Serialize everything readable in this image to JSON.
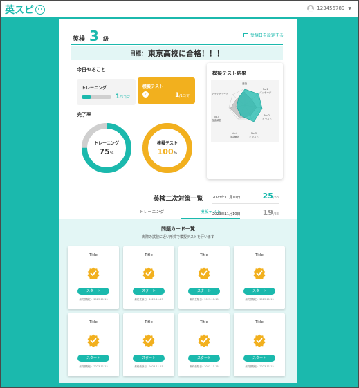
{
  "app": {
    "logo_text": "英スピ",
    "logo_icon": "face-icon"
  },
  "user": {
    "id": "123456789",
    "avatar_icon": "user-icon",
    "menu_icon": "caret-down-icon"
  },
  "header": {
    "grade_prefix": "英検",
    "grade_number": "3",
    "grade_suffix": "級",
    "exam_date_link": "受験日を設定する",
    "calendar_icon": "calendar-icon"
  },
  "goal": {
    "prefix": "目標：",
    "text": "東京高校に合格！！！"
  },
  "today": {
    "title": "今日やること",
    "training": {
      "label": "トレーニング",
      "done": "1",
      "total": "/3コマ",
      "progress": 0.33
    },
    "mock": {
      "label": "模擬テスト",
      "done": "1",
      "total": "/1コマ",
      "check_icon": "check-circle-icon"
    }
  },
  "completion": {
    "title": "完了率",
    "training": {
      "label": "トレーニング",
      "value": "75",
      "unit": "%",
      "percent": 75
    },
    "mock": {
      "label": "模擬テスト",
      "value": "100",
      "unit": "%",
      "percent": 100
    }
  },
  "results": {
    "title": "模擬テスト結果",
    "radar_labels": [
      "音読",
      "No.1\nパッセージ",
      "No.2\nイラスト",
      "No.3\nイラスト",
      "No.4\n自由解答",
      "No.5\n自由解答",
      "アティチュード"
    ],
    "scores": [
      {
        "date": "2023年11月10日",
        "value": "25",
        "total": "/33"
      },
      {
        "date": "2023年11月10日",
        "value": "19",
        "total": "/33"
      }
    ]
  },
  "list": {
    "title": "英検二次対策一覧",
    "tabs": [
      {
        "label": "トレーニング"
      },
      {
        "label": "模擬テスト"
      }
    ],
    "cards_title": "問題カード一覧",
    "cards_subtitle": "実際の試験に近い形式で模擬テストを行います",
    "cards": [
      {
        "title": "Title",
        "button": "スタート",
        "date": "最終受験日：2023-11-15"
      },
      {
        "title": "Title",
        "button": "スタート",
        "date": "最終受験日：2023-11-15"
      },
      {
        "title": "Title",
        "button": "スタート",
        "date": "最終受験日：2023-11-15"
      },
      {
        "title": "Title",
        "button": "スタート",
        "date": "最終受験日：2023-11-15"
      },
      {
        "title": "Title",
        "button": "スタート",
        "date": "最終受験日：2023-11-15"
      },
      {
        "title": "Title",
        "button": "スタート",
        "date": "最終受験日：2023-11-15"
      },
      {
        "title": "Title",
        "button": "スタート",
        "date": "最終受験日：2023-11-15"
      },
      {
        "title": "Title",
        "button": "スタート",
        "date": "最終受験日：2023-11-15"
      }
    ]
  },
  "colors": {
    "primary": "#1bb9ad",
    "accent": "#f2b01e",
    "gray": "#cfcfcf",
    "light": "#e3f6f5"
  }
}
